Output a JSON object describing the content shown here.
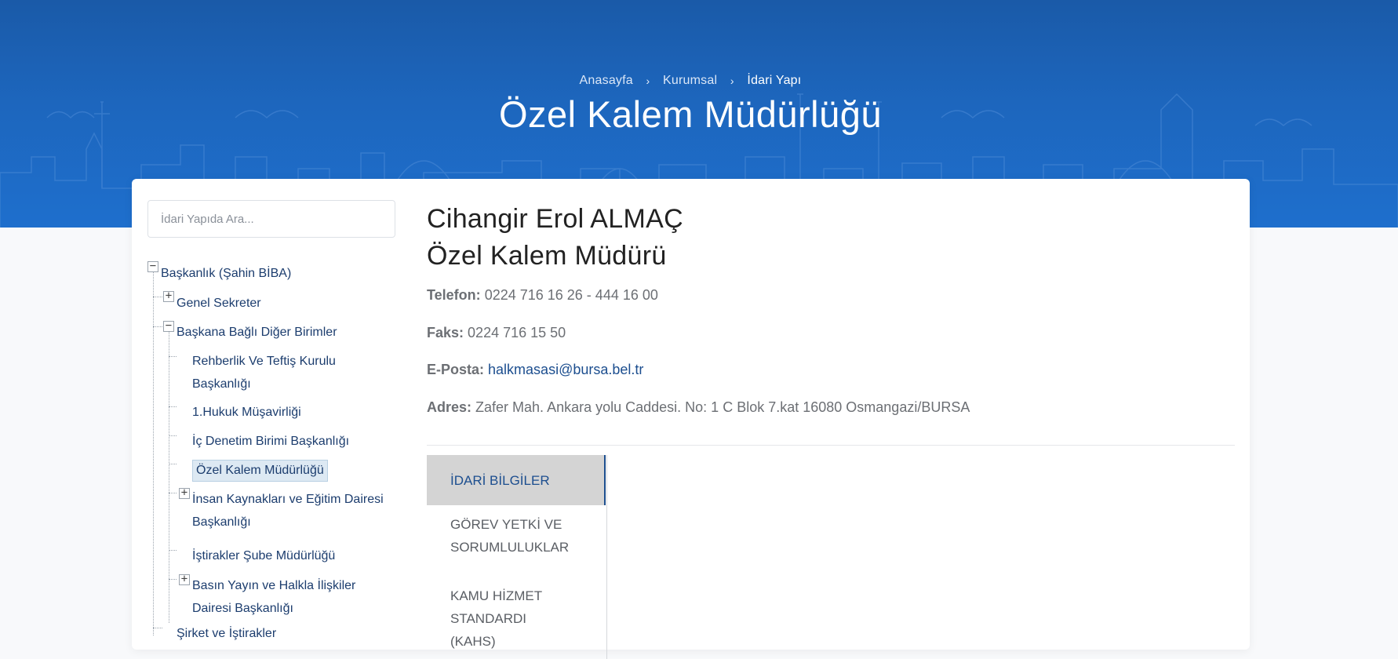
{
  "breadcrumb": {
    "home": "Anasayfa",
    "section": "Kurumsal",
    "current": "İdari Yapı"
  },
  "page_title": "Özel Kalem Müdürlüğü",
  "search": {
    "placeholder": "İdari Yapıda Ara..."
  },
  "tree": {
    "root": "Başkanlık (Şahin BİBA)",
    "genel_sekreter": "Genel Sekreter",
    "baskana_bagli": "Başkana Bağlı Diğer Birimler",
    "rehberlik_1": "Rehberlik Ve Teftiş Kurulu",
    "rehberlik_2": "Başkanlığı",
    "hukuk": "1.Hukuk Müşavirliği",
    "ic_denetim": "İç Denetim Birimi Başkanlığı",
    "ozel_kalem": "Özel Kalem Müdürlüğü",
    "insan_1": "İnsan Kaynakları ve Eğitim Dairesi",
    "insan_2": "Başkanlığı",
    "istirakler": "İştirakler Şube Müdürlüğü",
    "basin_1": "Basın Yayın ve Halkla İlişkiler",
    "basin_2": "Dairesi Başkanlığı",
    "sirket": "Şirket ve İştirakler"
  },
  "person": {
    "name": "Cihangir Erol ALMAÇ",
    "role": "Özel Kalem Müdürü"
  },
  "contact": {
    "phone_label": "Telefon:",
    "phone": "0224 716 16 26 - 444 16 00",
    "fax_label": "Faks:",
    "fax": "0224 716 15 50",
    "email_label": "E-Posta:",
    "email": "halkmasasi@bursa.bel.tr",
    "address_label": "Adres:",
    "address": "Zafer Mah. Ankara yolu Caddesi. No: 1 C Blok 7.kat 16080 Osmangazi/BURSA"
  },
  "tabs": {
    "t1": "İDARİ BİLGİLER",
    "t2_1": "GÖREV YETKİ VE",
    "t2_2": "SORUMLULUKLAR",
    "t3_1": "KAMU HİZMET",
    "t3_2": "STANDARDI",
    "t3_3": "(KAHS)"
  },
  "colors": {
    "hero_blue": "#1d66bd",
    "link_blue": "#1c4e8f",
    "active_tab_bg": "#d4d4d4"
  },
  "icons": {
    "breadcrumb_separator": "chevron-right-icon",
    "tree_expand": "plus-box-icon",
    "tree_collapse": "minus-box-icon"
  }
}
